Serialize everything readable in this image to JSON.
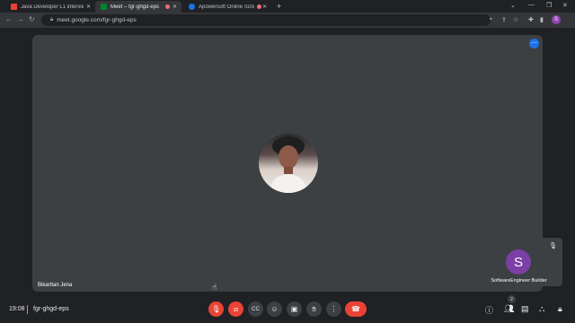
{
  "browser": {
    "tabs": [
      {
        "title": "Java Developer L1 interview - sca",
        "favicon_color": "#ea4335",
        "active": false
      },
      {
        "title": "Meet – fgr-ghgd-eps",
        "favicon_color": "#00832d",
        "active": true
      },
      {
        "title": "Apowersoft Online Screen Re",
        "favicon_color": "#1a73e8",
        "active": false
      }
    ],
    "new_tab_label": "+",
    "url": "meet.google.com/fgr-ghgd-eps",
    "profile_initial": "S"
  },
  "meeting": {
    "main_participant": {
      "name": "Bikarttan Jena"
    },
    "self_tile": {
      "initial": "S",
      "name": "SoftwareEngineer Builder"
    },
    "time": "19:08",
    "meeting_code": "fgr-ghgd-eps",
    "participants_count": "2"
  },
  "icons": {
    "tab_close": "close-icon",
    "mic": "microphone-off-icon",
    "camera": "camera-off-icon",
    "captions": "captions-icon",
    "emoji": "emoji-icon",
    "present": "present-screen-icon",
    "raise_hand": "raise-hand-icon",
    "more": "more-options-icon",
    "end_call": "end-call-icon",
    "info": "info-icon",
    "people": "people-icon",
    "chat": "chat-icon",
    "activities": "activities-icon",
    "host_controls": "host-controls-icon"
  },
  "colors": {
    "accent": "#1a73e8",
    "end_call": "#ea4335",
    "self_avatar": "#7b3fa6",
    "tile_bg": "#3c4043"
  }
}
